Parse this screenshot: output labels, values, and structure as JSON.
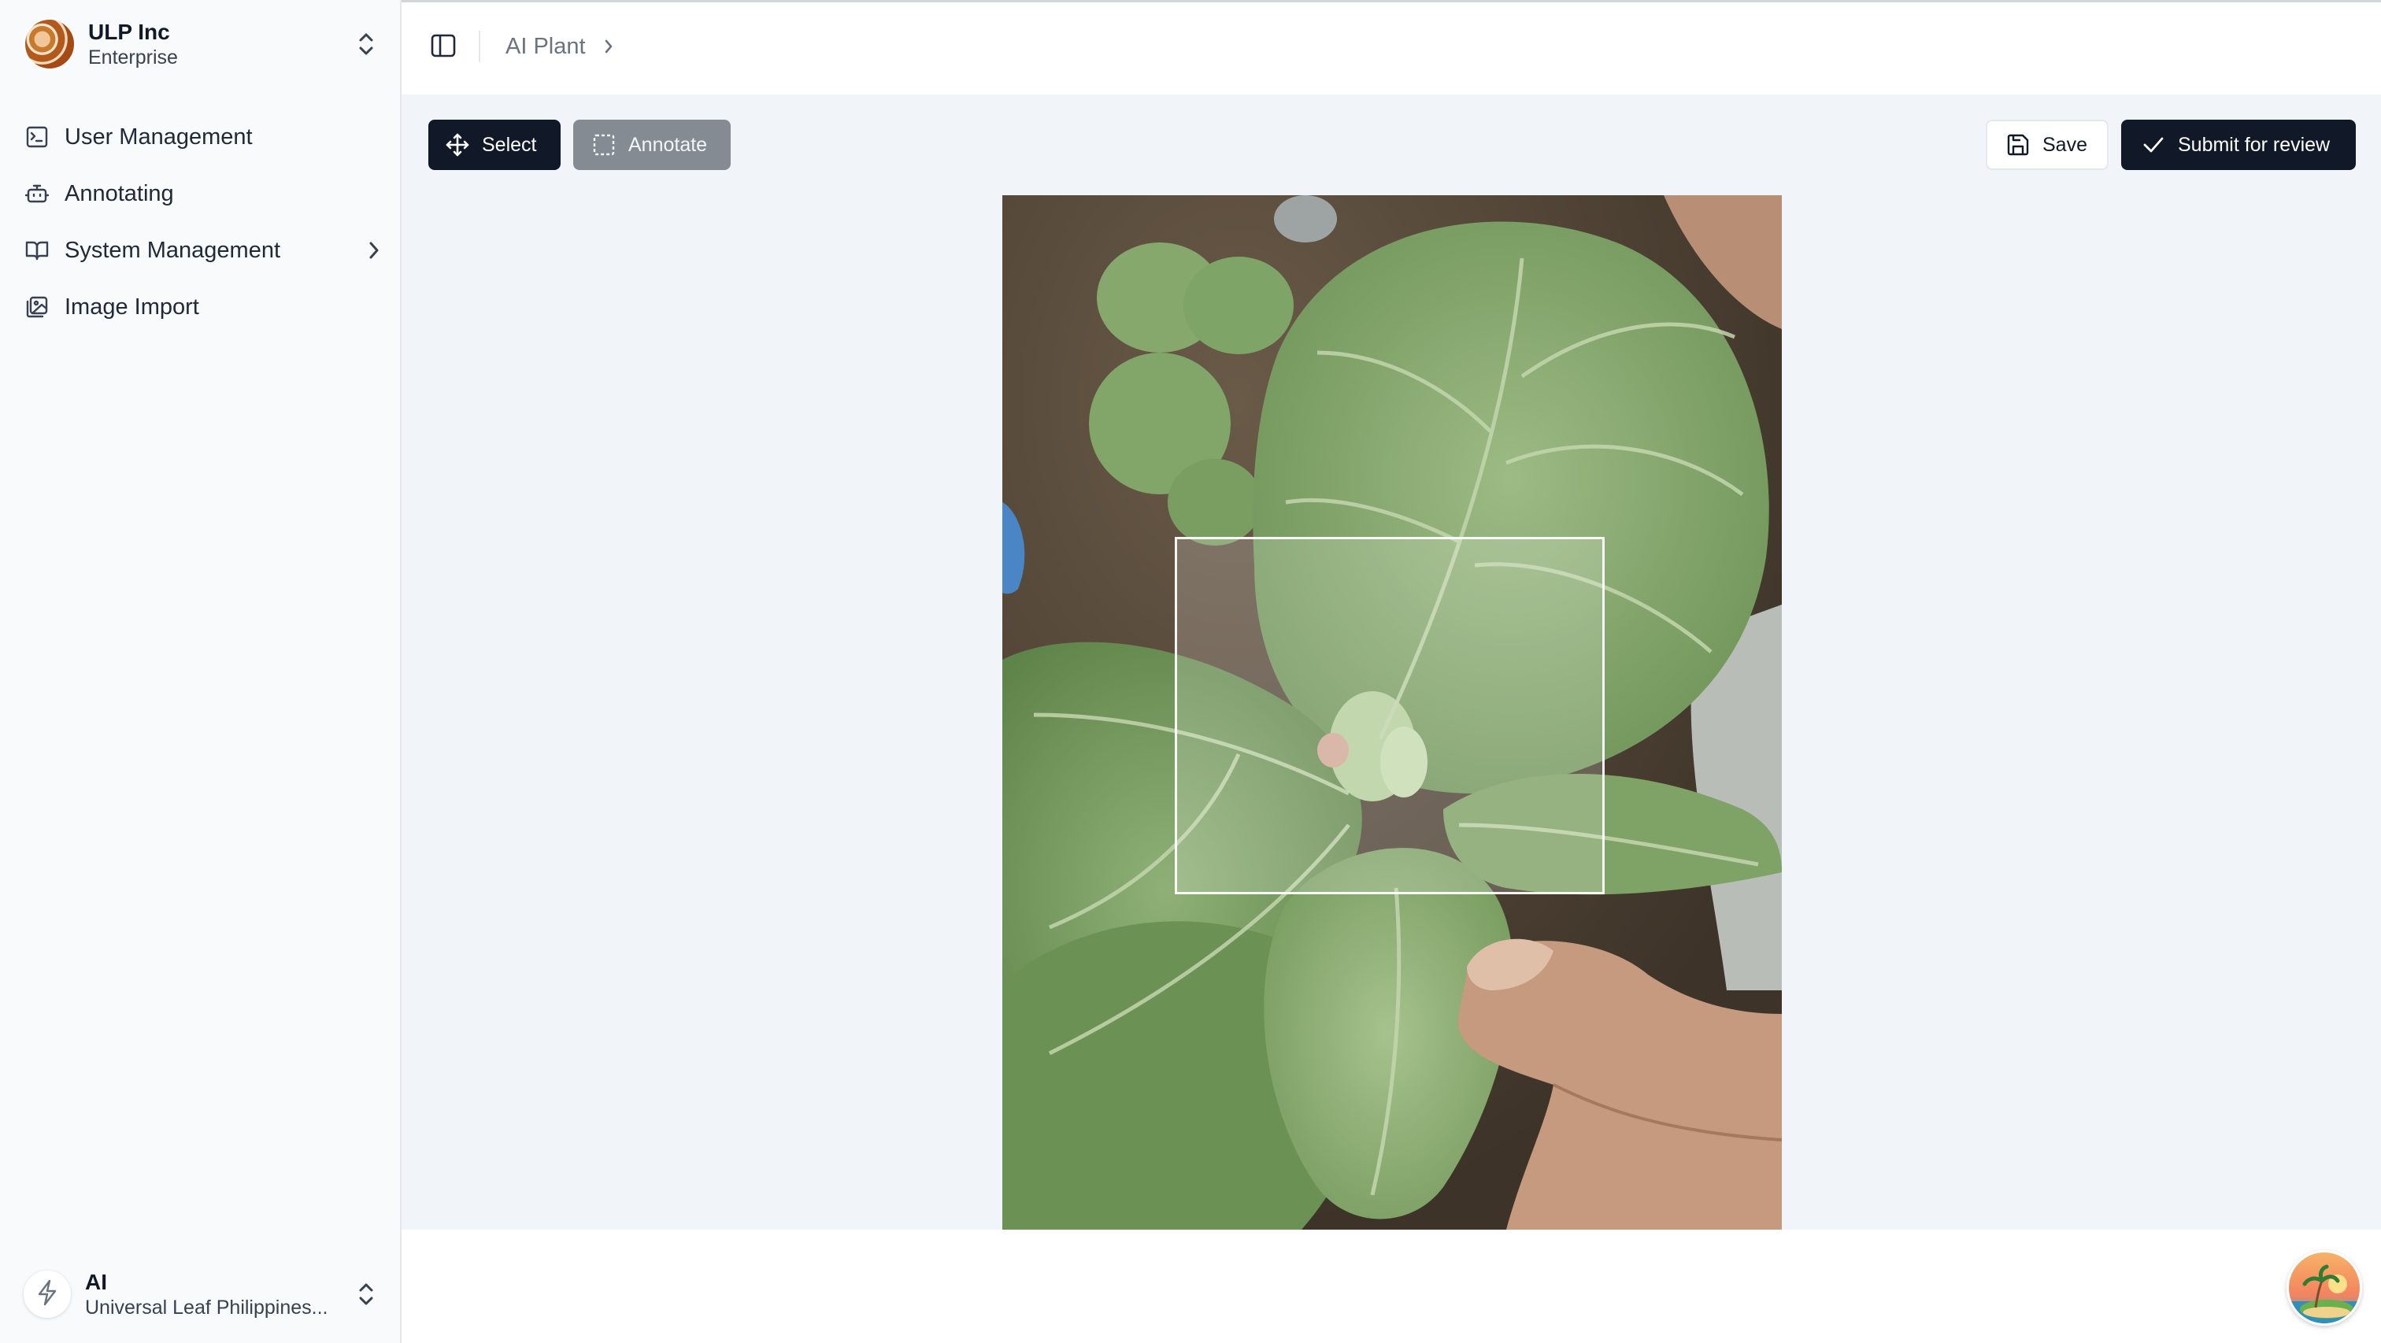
{
  "sidebar": {
    "org": {
      "name": "ULP Inc",
      "plan": "Enterprise"
    },
    "items": [
      {
        "label": "User Management",
        "icon": "user-management-icon"
      },
      {
        "label": "Annotating",
        "icon": "bot-icon"
      },
      {
        "label": "System Management",
        "icon": "book-open-icon",
        "has_submenu": true
      },
      {
        "label": "Image Import",
        "icon": "images-icon"
      }
    ],
    "user": {
      "name": "AI",
      "org": "Universal Leaf Philippines..."
    }
  },
  "header": {
    "breadcrumb": [
      "AI Plant"
    ]
  },
  "toolbar": {
    "select_label": "Select",
    "annotate_label": "Annotate",
    "save_label": "Save",
    "submit_label": "Submit for review"
  },
  "colors": {
    "primary": "#111827",
    "disabled_button": "#858b93",
    "workspace_bg": "#f1f5f9",
    "sidebar_bg": "#f8fafc"
  }
}
